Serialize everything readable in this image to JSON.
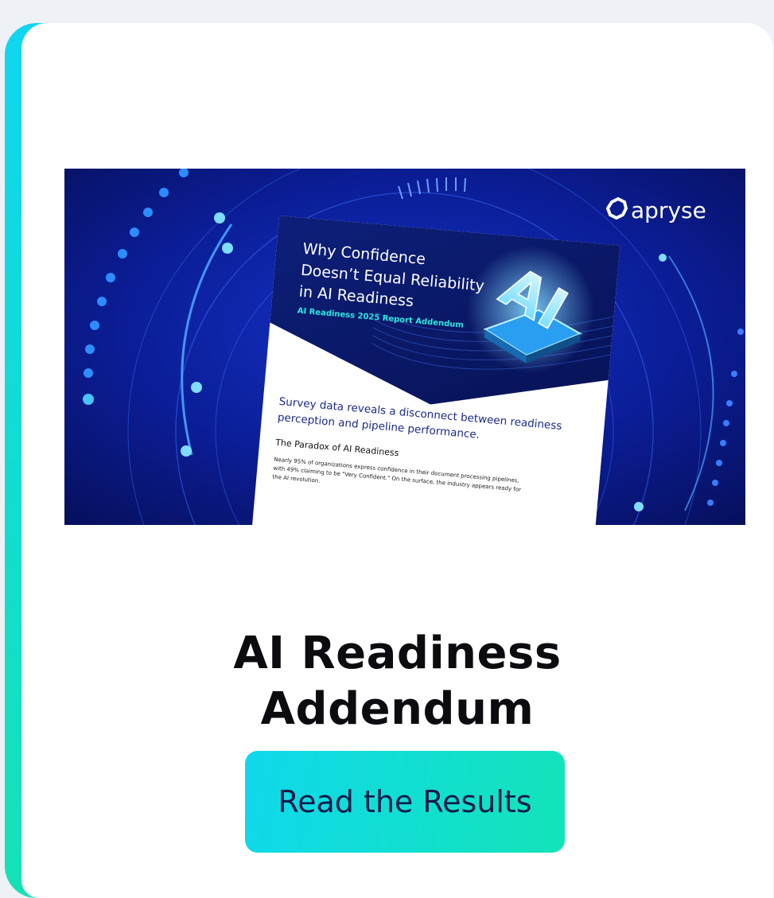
{
  "colors": {
    "accent_gradient_start": "#10d6f0",
    "accent_gradient_end": "#14e2b5",
    "banner_background": "#0a1a8a",
    "title_color": "#0b0b10",
    "cta_text_color": "#101a4a"
  },
  "banner": {
    "brand_logo_text": "apryse",
    "report": {
      "headline_line1": "Why Confidence",
      "headline_line2": "Doesn’t Equal Reliability",
      "headline_line3": "in AI Readiness",
      "tagline": "AI Readiness 2025 Report Addendum",
      "chip_text": "AI",
      "lead_line1": "Survey data reveals a disconnect between readiness",
      "lead_line2": "perception and pipeline performance.",
      "section_heading": "The Paradox of AI Readiness",
      "body_line1": "Nearly 95% of organizations express confidence in their document processing pipelines,",
      "body_line2": "with 49% claiming to be \"Very Confident.\" On the surface, the industry appears ready for",
      "body_line3": "the AI revolution."
    }
  },
  "card": {
    "title_line1": "AI Readiness",
    "title_line2": "Addendum",
    "cta_label": "Read the Results"
  }
}
